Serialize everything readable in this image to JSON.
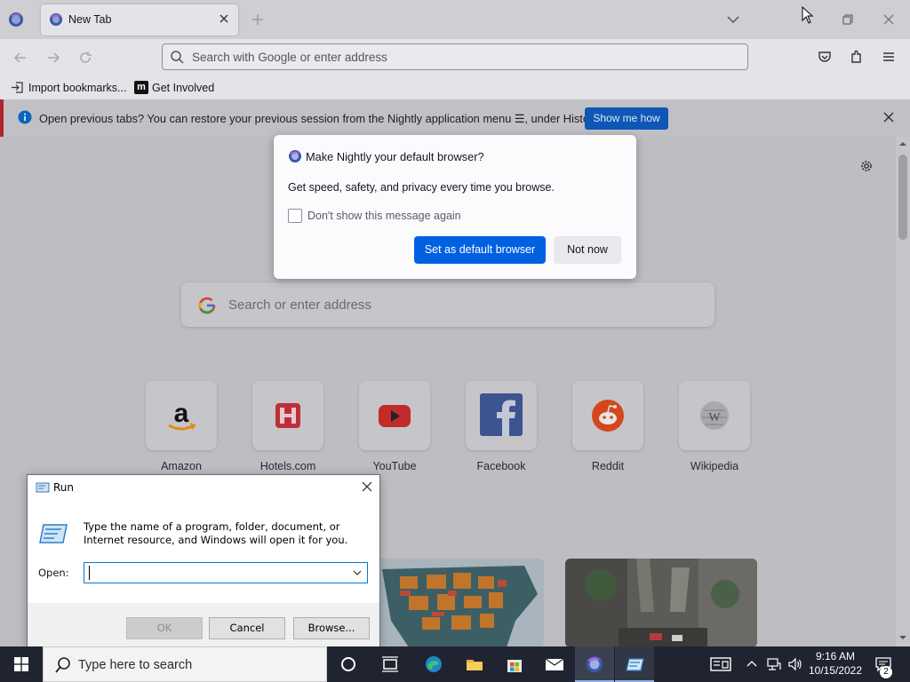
{
  "browser": {
    "tab_title": "New Tab",
    "url_placeholder": "Search with Google or enter address",
    "bookmarks": [
      {
        "label": "Import bookmarks..."
      },
      {
        "label": "Get Involved",
        "icon_text": "m"
      }
    ],
    "notification": {
      "text": "Open previous tabs? You can restore your previous session from the Nightly application menu ☰, under History.",
      "button": "Show me how"
    }
  },
  "newtab": {
    "search_placeholder": "Search or enter address",
    "top_sites": [
      {
        "label": "Amazon",
        "icon": "amazon-icon"
      },
      {
        "label": "Hotels.com",
        "icon": "hotels-icon"
      },
      {
        "label": "YouTube",
        "icon": "youtube-icon"
      },
      {
        "label": "Facebook",
        "icon": "facebook-icon"
      },
      {
        "label": "Reddit",
        "icon": "reddit-icon"
      },
      {
        "label": "Wikipedia",
        "icon": "wikipedia-icon"
      }
    ]
  },
  "default_dialog": {
    "title": "Make Nightly your default browser?",
    "body": "Get speed, safety, and privacy every time you browse.",
    "checkbox_label": "Don't show this message again",
    "checkbox_checked": false,
    "primary_button": "Set as default browser",
    "secondary_button": "Not now"
  },
  "run_dialog": {
    "title": "Run",
    "description": "Type the name of a program, folder, document, or Internet resource, and Windows will open it for you.",
    "open_label": "Open:",
    "open_value": "",
    "ok": "OK",
    "cancel": "Cancel",
    "browse": "Browse..."
  },
  "taskbar": {
    "search_placeholder": "Type here to search",
    "time": "9:16 AM",
    "date": "10/15/2022",
    "notification_count": "2"
  },
  "colors": {
    "accent_blue": "#0061e0",
    "notify_button": "#0e57b6",
    "taskbar": "#1f2430"
  }
}
